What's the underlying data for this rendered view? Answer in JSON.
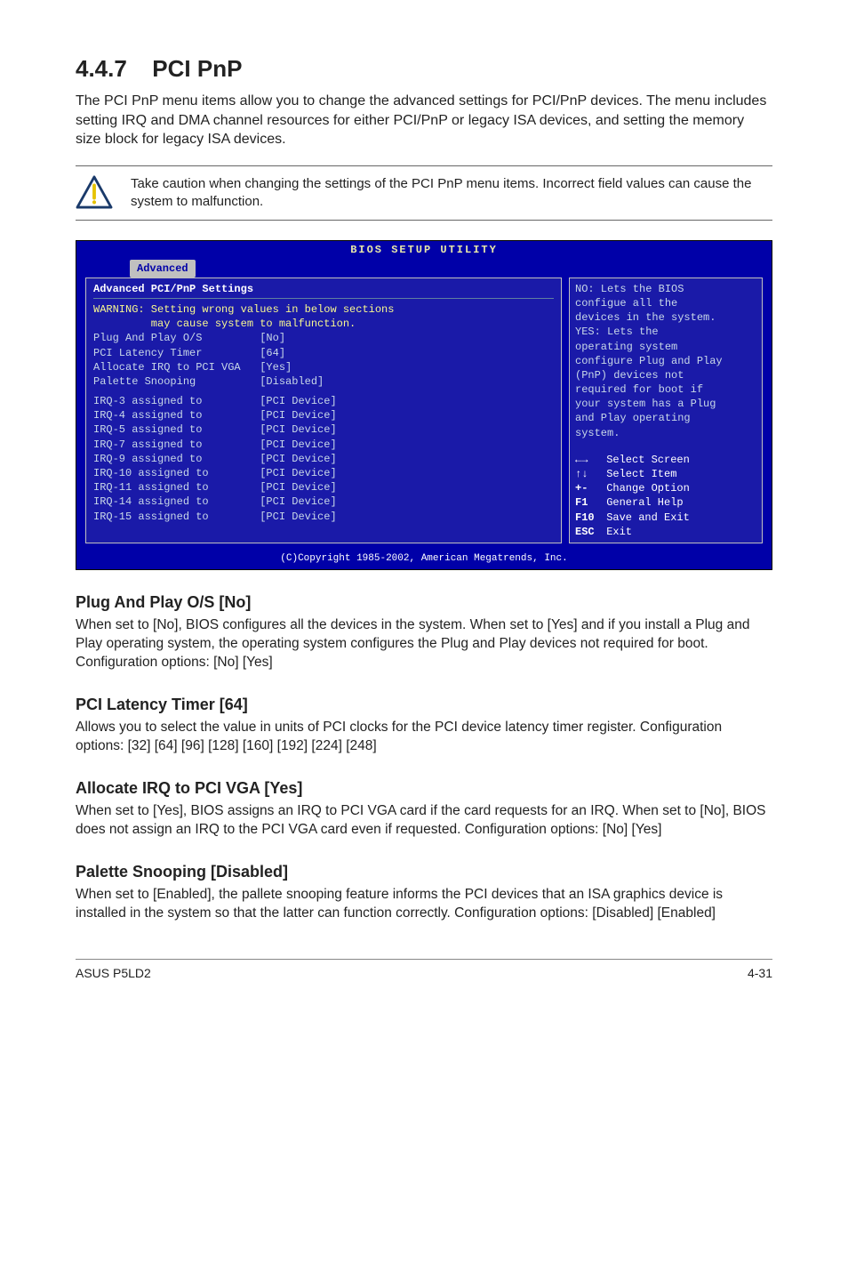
{
  "section": {
    "number": "4.4.7",
    "title": "PCI PnP"
  },
  "intro": "The PCI PnP menu items allow you to change the advanced settings for PCI/PnP devices. The menu includes setting IRQ and DMA channel resources for either PCI/PnP or legacy ISA devices, and setting the memory size block for legacy ISA devices.",
  "caution": "Take caution when changing the settings of the PCI PnP menu items. Incorrect field values can cause the system to malfunction.",
  "bios": {
    "title": "BIOS SETUP UTILITY",
    "tab": "Advanced",
    "left_header": "Advanced PCI/PnP Settings",
    "warning_l1": "WARNING: Setting wrong values in below sections",
    "warning_l2": "         may cause system to malfunction.",
    "items": [
      {
        "label": "Plug And Play O/S",
        "value": "[No]"
      },
      {
        "label": "PCI Latency Timer",
        "value": "[64]"
      },
      {
        "label": "Allocate IRQ to PCI VGA",
        "value": "[Yes]"
      },
      {
        "label": "Palette Snooping",
        "value": "[Disabled]"
      }
    ],
    "irqs": [
      {
        "label": "IRQ-3 assigned to",
        "value": "[PCI Device]"
      },
      {
        "label": "IRQ-4 assigned to",
        "value": "[PCI Device]"
      },
      {
        "label": "IRQ-5 assigned to",
        "value": "[PCI Device]"
      },
      {
        "label": "IRQ-7 assigned to",
        "value": "[PCI Device]"
      },
      {
        "label": "IRQ-9 assigned to",
        "value": "[PCI Device]"
      },
      {
        "label": "IRQ-10 assigned to",
        "value": "[PCI Device]"
      },
      {
        "label": "IRQ-11 assigned to",
        "value": "[PCI Device]"
      },
      {
        "label": "IRQ-14 assigned to",
        "value": "[PCI Device]"
      },
      {
        "label": "IRQ-15 assigned to",
        "value": "[PCI Device]"
      }
    ],
    "help_lines": [
      "NO: Lets the BIOS",
      "configue all the",
      "devices in the system.",
      "YES: Lets the",
      "operating system",
      "configure Plug and Play",
      "(PnP) devices not",
      "required for boot if",
      "your system has a Plug",
      "and Play operating",
      "system."
    ],
    "nav": [
      {
        "key": "←→",
        "label": "Select Screen"
      },
      {
        "key": "↑↓",
        "label": "Select Item"
      },
      {
        "key": "+-",
        "label": "Change Option"
      },
      {
        "key": "F1",
        "label": "General Help"
      },
      {
        "key": "F10",
        "label": "Save and Exit"
      },
      {
        "key": "ESC",
        "label": "Exit"
      }
    ],
    "footer": "(C)Copyright 1985-2002, American Megatrends, Inc."
  },
  "subs": {
    "pnp": {
      "title": "Plug And Play O/S [No]",
      "text": "When set to [No], BIOS configures all the devices in the system. When set to [Yes] and if you install a Plug and Play operating system, the operating system configures the Plug and Play devices not required for boot. Configuration options: [No] [Yes]"
    },
    "latency": {
      "title": "PCI Latency Timer [64]",
      "text": "Allows you to select the value in units of PCI clocks for the PCI device latency timer register. Configuration options: [32] [64] [96] [128] [160] [192] [224] [248]"
    },
    "irq": {
      "title": "Allocate IRQ to PCI VGA [Yes]",
      "text": "When set to [Yes], BIOS assigns an IRQ to PCI VGA card if the card requests for an IRQ. When set to [No], BIOS does not assign an IRQ to the PCI VGA card even if requested. Configuration options: [No] [Yes]"
    },
    "palette": {
      "title": "Palette Snooping [Disabled]",
      "text": "When set to [Enabled], the pallete snooping feature informs the PCI devices that an ISA graphics device is installed in the system so that the latter can function correctly. Configuration options: [Disabled] [Enabled]"
    }
  },
  "footer": {
    "left": "ASUS P5LD2",
    "right": "4-31"
  }
}
